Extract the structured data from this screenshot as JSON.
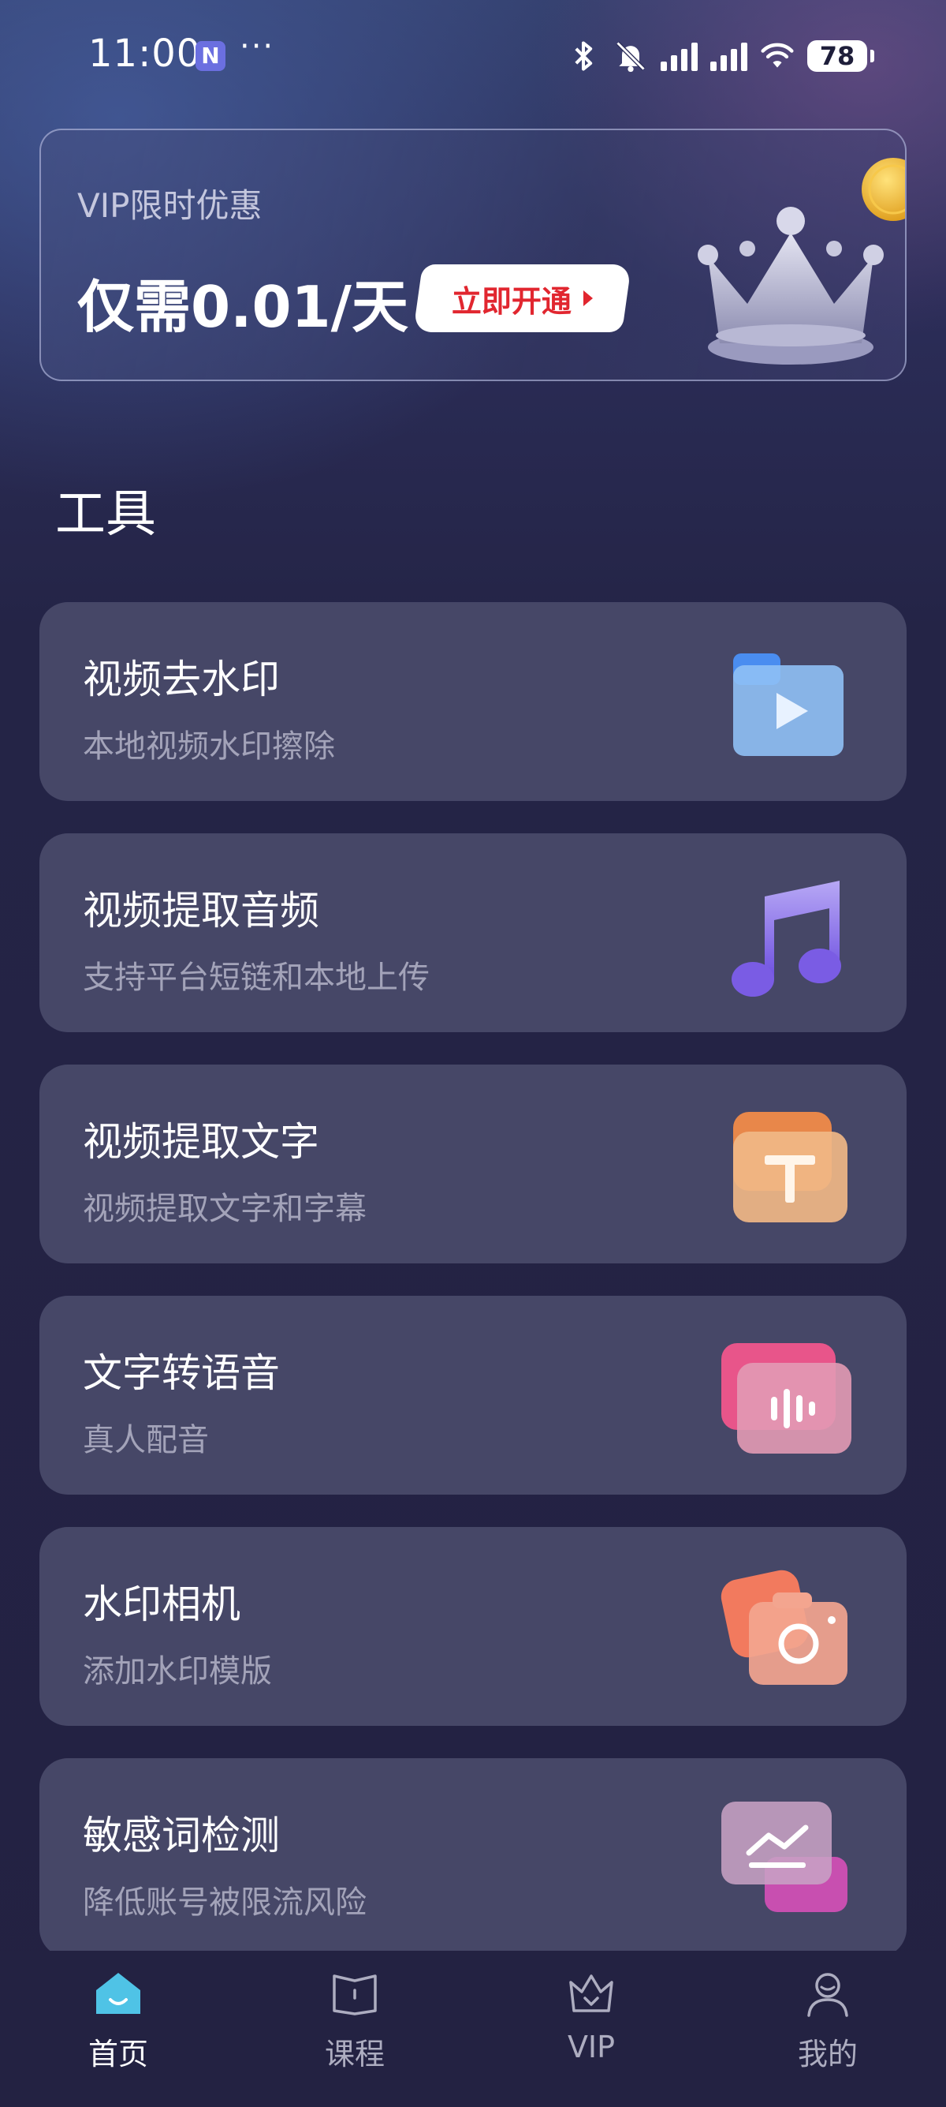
{
  "status_bar": {
    "time": "11:00",
    "notification_badge": "N",
    "more_dots": "···",
    "battery": "78"
  },
  "vip_banner": {
    "title": "VIP限时优惠",
    "price": "仅需0.01/天",
    "button_label": "立即开通"
  },
  "tools_section": {
    "title": "工具",
    "items": [
      {
        "name": "视频去水印",
        "desc": "本地视频水印擦除",
        "icon": "video-play-icon",
        "color": "#8fc0f5"
      },
      {
        "name": "视频提取音频",
        "desc": "支持平台短链和本地上传",
        "icon": "music-note-icon",
        "color": "#8b72e8"
      },
      {
        "name": "视频提取文字",
        "desc": "视频提取文字和字幕",
        "icon": "text-t-icon",
        "color": "#e8a66c"
      },
      {
        "name": "文字转语音",
        "desc": "真人配音",
        "icon": "audio-wave-icon",
        "color": "#e86a9a"
      },
      {
        "name": "水印相机",
        "desc": "添加水印模版",
        "icon": "camera-icon",
        "color": "#f58a72"
      },
      {
        "name": "敏感词检测",
        "desc": "降低账号被限流风险",
        "icon": "trend-chart-icon",
        "color": "#d06ab8"
      }
    ]
  },
  "bottom_nav": {
    "items": [
      {
        "label": "首页",
        "icon": "home-icon",
        "active": true
      },
      {
        "label": "课程",
        "icon": "book-icon",
        "active": false
      },
      {
        "label": "VIP",
        "icon": "crown-icon",
        "active": false
      },
      {
        "label": "我的",
        "icon": "profile-icon",
        "active": false
      }
    ]
  },
  "colors": {
    "background": "#232142",
    "card": "#464767",
    "vip_button_text": "#e1262f",
    "nav_active": "#4fc3e6"
  }
}
